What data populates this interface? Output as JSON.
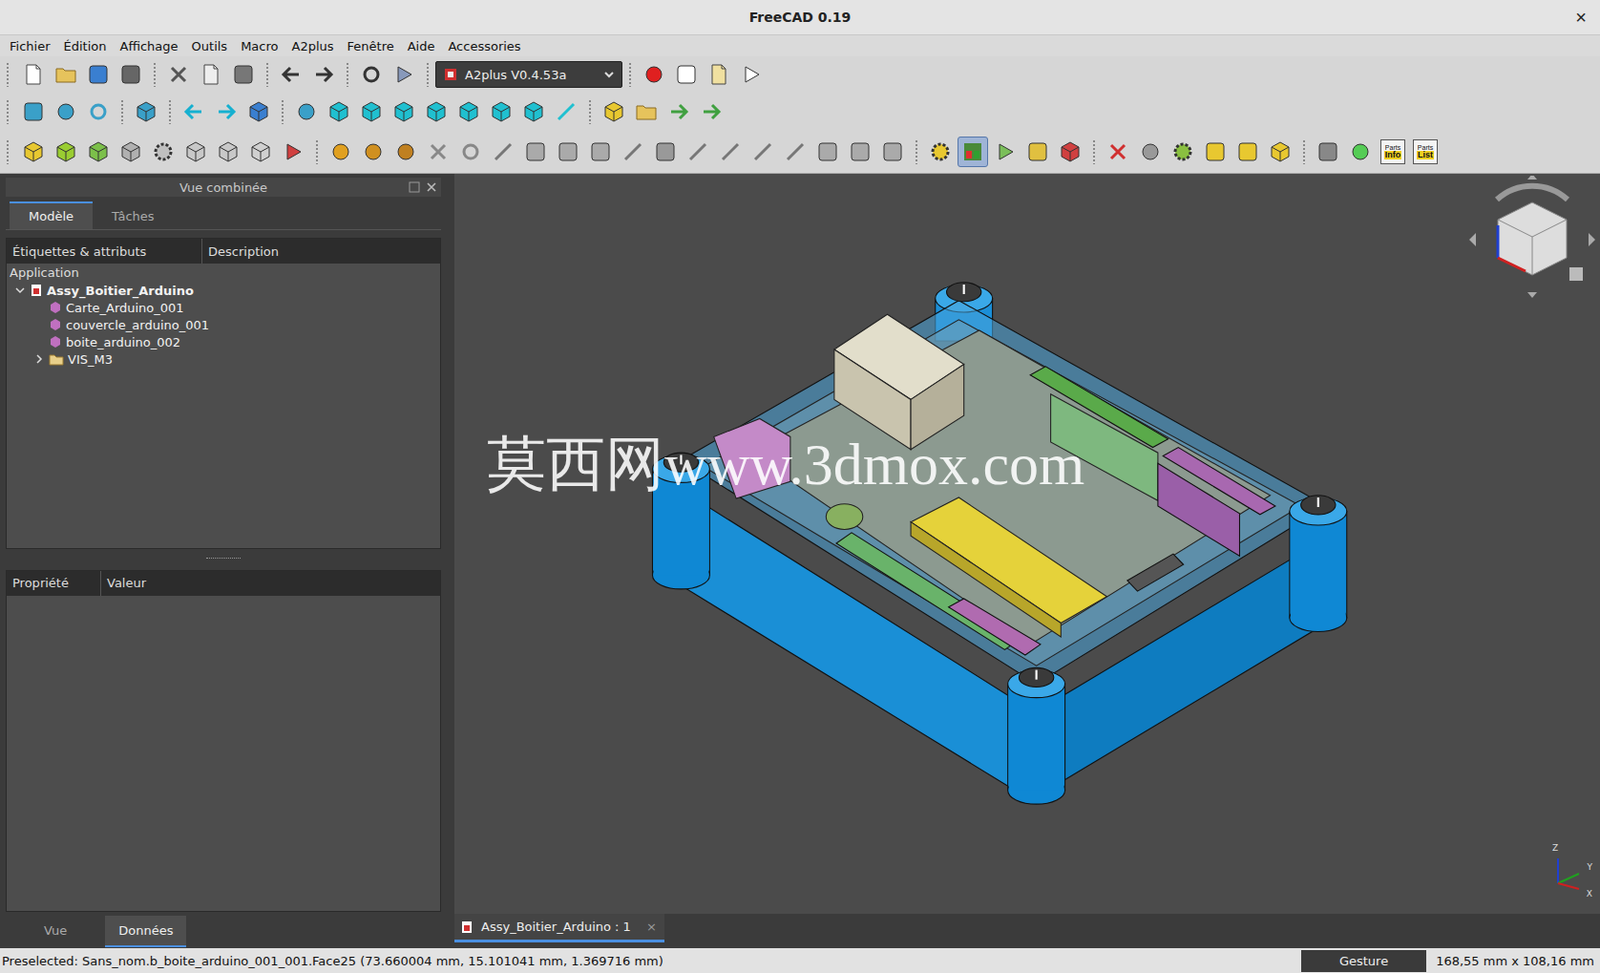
{
  "window": {
    "title": "FreeCAD 0.19",
    "close": "×"
  },
  "menu": [
    "Fichier",
    "Édition",
    "Affichage",
    "Outils",
    "Macro",
    "A2plus",
    "Fenêtre",
    "Aide",
    "Accessories"
  ],
  "workbench": {
    "value": "A2plus V0.4.53a"
  },
  "auto_solve": {
    "selected": true
  },
  "parts_buttons": [
    {
      "top": "Parts",
      "bottom": "Info"
    },
    {
      "top": "Parts",
      "bottom": "List"
    }
  ],
  "combo_view": {
    "title": "Vue combinée",
    "tabs": [
      {
        "label": "Modèle",
        "selected": true
      },
      {
        "label": "Tâches",
        "selected": false
      }
    ]
  },
  "tree": {
    "columns": [
      "Étiquettes & attributs",
      "Description"
    ],
    "root_label": "Application",
    "items": [
      {
        "label": "Assy_Boitier_Arduino",
        "kind": "document",
        "depth": 0,
        "expanded": true
      },
      {
        "label": "Carte_Arduino_001",
        "kind": "part",
        "depth": 1,
        "expanded": false
      },
      {
        "label": "couvercle_arduino_001",
        "kind": "part",
        "depth": 1,
        "expanded": false
      },
      {
        "label": "boite_arduino_002",
        "kind": "part",
        "depth": 1,
        "expanded": false
      },
      {
        "label": "VIS_M3",
        "kind": "folder",
        "depth": 1,
        "expanded": false
      }
    ]
  },
  "properties": {
    "columns": [
      "Propriété",
      "Valeur"
    ]
  },
  "bottom_tabs": [
    {
      "label": "Vue",
      "selected": false
    },
    {
      "label": "Données",
      "selected": true
    }
  ],
  "document_tabs": [
    {
      "label": "Assy_Boitier_Arduino : 1",
      "selected": true,
      "close": "×"
    }
  ],
  "watermark": "莫西网www.3dmox.com",
  "axes": [
    "Z",
    "Y",
    "X"
  ],
  "status_bar": {
    "message": "Preselected: Sans_nom.b_boite_arduino_001_001.Face25 (73.660004 mm, 15.101041 mm, 1.369716 mm)",
    "navigation": "Gesture",
    "dimensions": "168,55 mm x 108,16 mm"
  }
}
